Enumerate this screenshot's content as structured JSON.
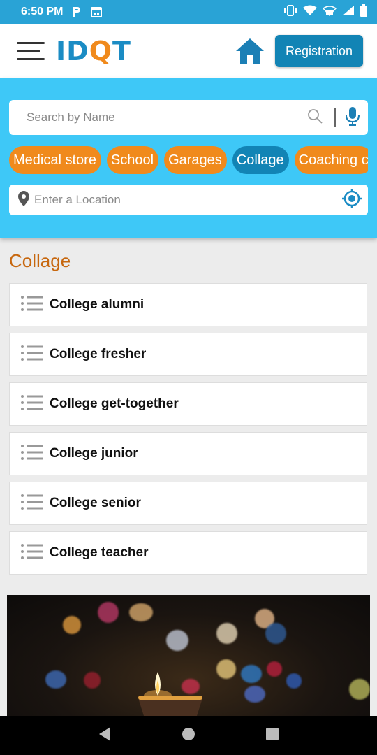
{
  "status_bar": {
    "time": "6:50 PM"
  },
  "header": {
    "logo": {
      "part1": "ID",
      "part2": "Q",
      "part3": "T"
    },
    "registration_label": "Registration"
  },
  "search": {
    "placeholder": "Search by Name"
  },
  "categories": [
    "Medical store",
    "School",
    "Garages",
    "Collage",
    "Coaching c"
  ],
  "selected_category": "Collage",
  "location": {
    "placeholder": "Enter a Location"
  },
  "section": {
    "title": "Collage",
    "items": [
      "College alumni",
      "College fresher",
      "College get-together",
      "College junior",
      "College senior",
      "College teacher"
    ]
  },
  "colors": {
    "status_bar": "#29a3d6",
    "search_panel": "#3ec8f7",
    "chip_orange": "#f08a1c",
    "chip_active": "#1284b5",
    "section_title": "#c7670e"
  }
}
